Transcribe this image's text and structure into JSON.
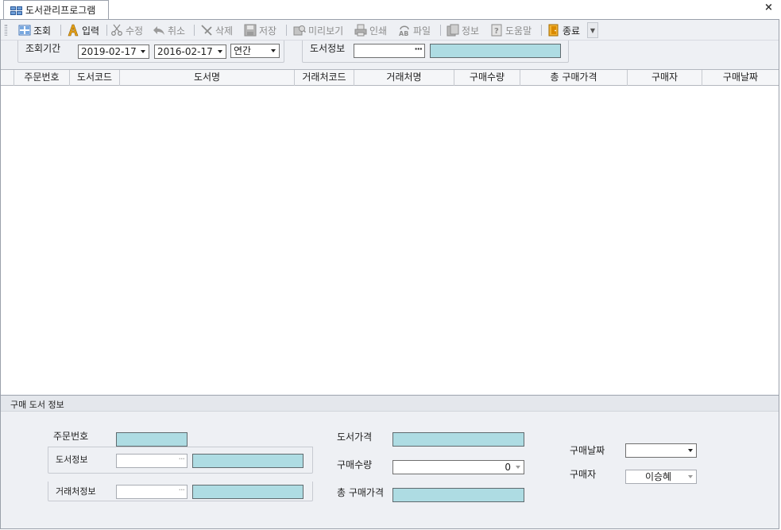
{
  "window": {
    "tab_title": "도서관리프로그램",
    "close_symbol": "×"
  },
  "toolbar": {
    "items": [
      {
        "label": "조회",
        "icon": "grid-view-icon",
        "enabled": true
      },
      {
        "label": "입력",
        "icon": "font-a-icon",
        "enabled": true
      },
      {
        "label": "수정",
        "icon": "scissors-icon",
        "enabled": false
      },
      {
        "label": "취소",
        "icon": "undo-arrow-icon",
        "enabled": false
      },
      {
        "label": "삭제",
        "icon": "delete-cross-icon",
        "enabled": false
      },
      {
        "label": "저장",
        "icon": "floppy-disk-icon",
        "enabled": false
      },
      {
        "label": "미리보기",
        "icon": "preview-icon",
        "enabled": false
      },
      {
        "label": "인쇄",
        "icon": "printer-icon",
        "enabled": false
      },
      {
        "label": "파일",
        "icon": "file-ab-icon",
        "enabled": false
      },
      {
        "label": "정보",
        "icon": "info-clipboard-icon",
        "enabled": false
      },
      {
        "label": "도움말",
        "icon": "help-question-icon",
        "enabled": false
      },
      {
        "label": "종료",
        "icon": "exit-door-icon",
        "enabled": true
      }
    ]
  },
  "filter": {
    "period_label": "조회기간",
    "date_from": "2019-02-17",
    "date_to": "2016-02-17",
    "period_type": "연간",
    "book_info_label": "도서정보",
    "book_picker_symbol": "···"
  },
  "grid": {
    "columns": [
      "주문번호",
      "도서코드",
      "도서명",
      "거래처코드",
      "거래처명",
      "구매수량",
      "총 구매가격",
      "구매자",
      "구매날짜"
    ],
    "rows": []
  },
  "detail": {
    "title": "구매 도서 정보",
    "order_no_label": "주문번호",
    "book_info_label": "도서정보",
    "vendor_info_label": "거래처정보",
    "picker_symbol": "···",
    "price_label": "도서가격",
    "quantity_label": "구매수량",
    "quantity_value": "0",
    "total_price_label": "총 구매가격",
    "purchase_date_label": "구매날짜",
    "buyer_label": "구매자",
    "buyer_value": "이승혜"
  },
  "colors": {
    "readonly_field": "#aedce3",
    "panel_bg": "#eef0f4",
    "disabled_text": "#8c8c8c"
  }
}
